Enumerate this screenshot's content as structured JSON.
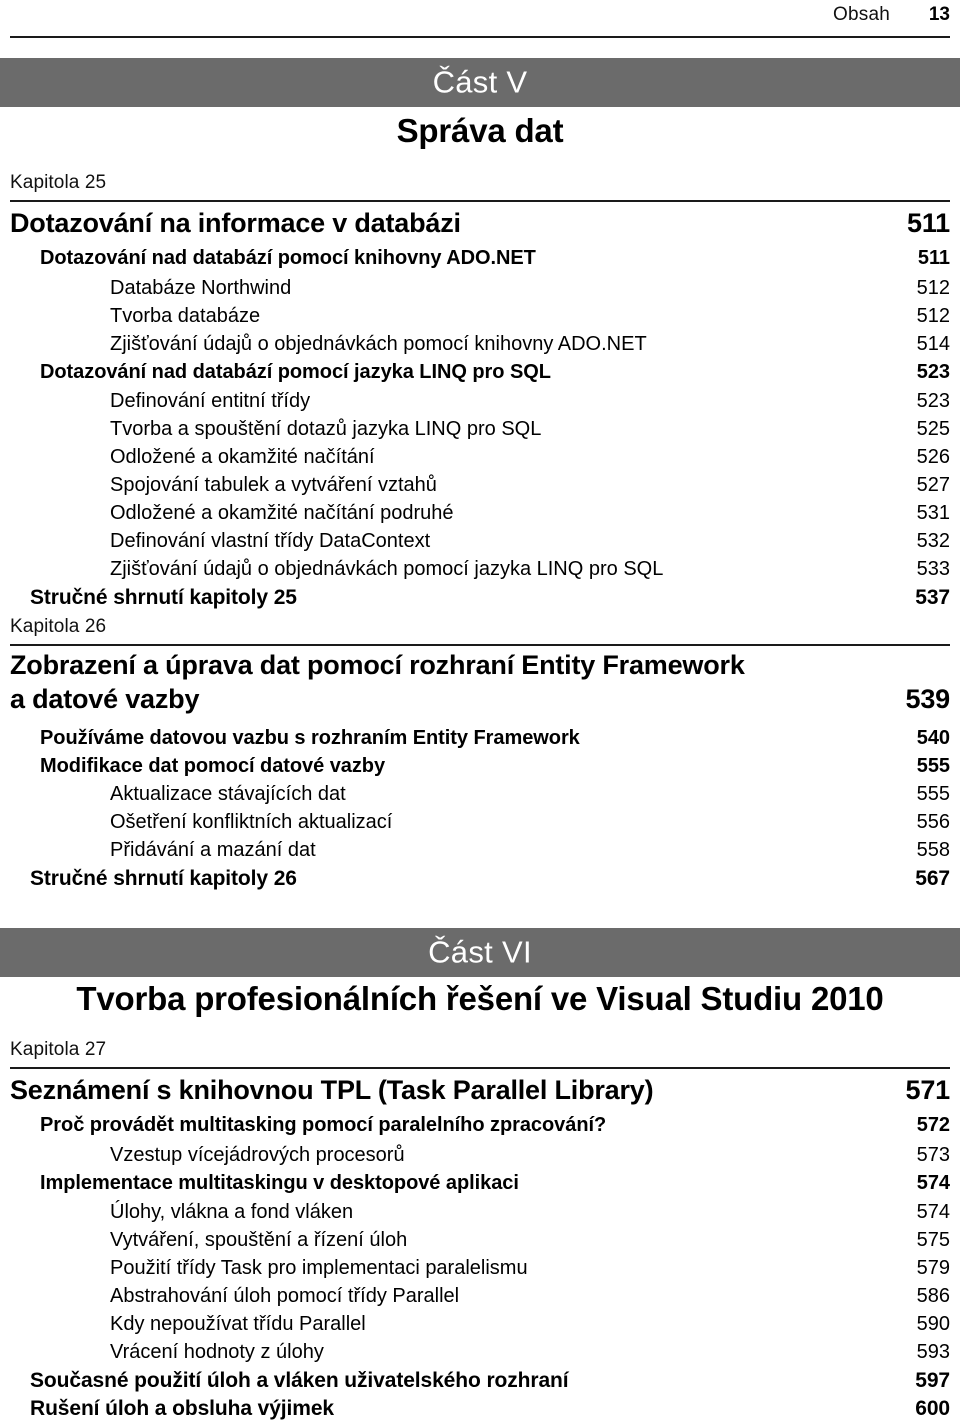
{
  "header": {
    "label": "Obsah",
    "folio": "13"
  },
  "parts": [
    {
      "label": "Část V",
      "title": "Správa dat"
    },
    {
      "label": "Část VI",
      "title": "Tvorba profesionálních řešení ve Visual Studiu 2010"
    }
  ],
  "chapters": [
    {
      "kapitola": "Kapitola 25",
      "title": "Dotazování na informace v databázi",
      "page": "511",
      "entries": [
        {
          "level": "a",
          "text": "Dotazování nad databází pomocí knihovny ADO.NET",
          "page": "511"
        },
        {
          "level": "b",
          "text": "Databáze Northwind",
          "page": "512"
        },
        {
          "level": "b",
          "text": "Tvorba databáze",
          "page": "512"
        },
        {
          "level": "b",
          "text": "Zjišťování údajů o objednávkách pomocí knihovny ADO.NET",
          "page": "514"
        },
        {
          "level": "a",
          "text": "Dotazování nad databází pomocí jazyka LINQ pro SQL",
          "page": "523"
        },
        {
          "level": "b",
          "text": "Definování entitní třídy",
          "page": "523"
        },
        {
          "level": "b",
          "text": "Tvorba a spouštění dotazů jazyka LINQ pro SQL",
          "page": "525"
        },
        {
          "level": "b",
          "text": "Odložené a okamžité načítání",
          "page": "526"
        },
        {
          "level": "b",
          "text": "Spojování tabulek a vytváření vztahů",
          "page": "527"
        },
        {
          "level": "b",
          "text": "Odložené a okamžité načítání podruhé",
          "page": "531"
        },
        {
          "level": "b",
          "text": "Definování vlastní třídy DataContext",
          "page": "532"
        },
        {
          "level": "b",
          "text": "Zjišťování údajů o objednávkách pomocí jazyka LINQ pro SQL",
          "page": "533"
        },
        {
          "level": "sum",
          "text": "Stručné shrnutí kapitoly 25",
          "page": "537"
        }
      ]
    },
    {
      "kapitola": "Kapitola 26",
      "title_line1": "Zobrazení a úprava dat pomocí rozhraní Entity Framework",
      "title_line2": "a datové vazby",
      "page": "539",
      "entries": [
        {
          "level": "a",
          "text": "Používáme datovou vazbu s rozhraním Entity Framework",
          "page": "540"
        },
        {
          "level": "a",
          "text": "Modifikace dat pomocí datové vazby",
          "page": "555"
        },
        {
          "level": "b",
          "text": "Aktualizace stávajících dat",
          "page": "555"
        },
        {
          "level": "b",
          "text": "Ošetření konfliktních aktualizací",
          "page": "556"
        },
        {
          "level": "b",
          "text": "Přidávání a mazání dat",
          "page": "558"
        },
        {
          "level": "sum",
          "text": "Stručné shrnutí kapitoly 26",
          "page": "567"
        }
      ]
    },
    {
      "kapitola": "Kapitola 27",
      "title": "Seznámení s knihovnou TPL (Task Parallel Library)",
      "page": "571",
      "entries": [
        {
          "level": "a",
          "text": "Proč provádět multitasking pomocí paralelního zpracování?",
          "page": "572"
        },
        {
          "level": "b",
          "text": "Vzestup vícejádrových procesorů",
          "page": "573"
        },
        {
          "level": "a",
          "text": "Implementace multitaskingu v desktopové aplikaci",
          "page": "574"
        },
        {
          "level": "b",
          "text": "Úlohy, vlákna a fond vláken",
          "page": "574"
        },
        {
          "level": "b",
          "text": "Vytváření, spouštění a řízení úloh",
          "page": "575"
        },
        {
          "level": "b",
          "text": "Použití třídy Task pro implementaci paralelismu",
          "page": "579"
        },
        {
          "level": "b",
          "text": "Abstrahování úloh pomocí třídy Parallel",
          "page": "586"
        },
        {
          "level": "b",
          "text": "Kdy nepoužívat třídu Parallel",
          "page": "590"
        },
        {
          "level": "b",
          "text": "Vrácení hodnoty z úlohy",
          "page": "593"
        },
        {
          "level": "sum",
          "text": "Současné použití úloh a vláken uživatelského rozhraní",
          "page": "597"
        },
        {
          "level": "sum",
          "text": "Rušení úloh a obsluha výjimek",
          "page": "600"
        }
      ]
    }
  ],
  "colors": {
    "band": "#6b6b6b",
    "rule": "#1a1a1a",
    "text": "#000000"
  }
}
